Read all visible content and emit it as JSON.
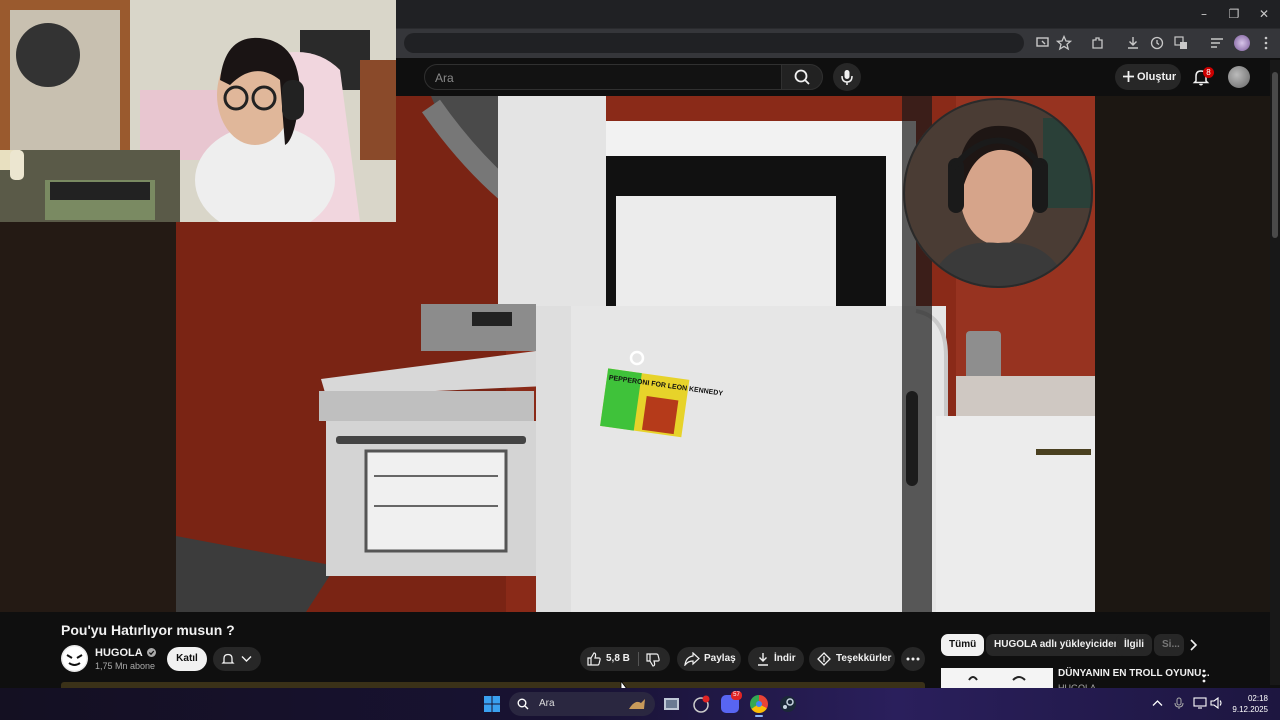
{
  "browser": {
    "window_controls": {
      "minimize": "–",
      "maximize": "❐",
      "close": "✕"
    }
  },
  "youtube": {
    "search_placeholder": "Ara",
    "create_label": "Oluştur",
    "notification_count": "8"
  },
  "video": {
    "title": "Pou'yu Hatırlıyor musun ?",
    "channel": "HUGOLA",
    "subscribers": "1,75 Mn abone",
    "join_label": "Katıl",
    "like_count": "5,8 B",
    "share_label": "Paylaş",
    "download_label": "İndir",
    "thanks_label": "Teşekkürler",
    "sticker_text": "PEPPERONI FOR LEON KENNEDY"
  },
  "sidebar": {
    "chips": [
      "Tümü",
      "HUGOLA adlı yükleyiciden",
      "İlgili",
      "Si..."
    ],
    "recommended": [
      {
        "title": "DÜNYANIN EN TROLL OYUNU...",
        "channel": "HUGOLA"
      }
    ]
  },
  "taskbar": {
    "search_label": "Ara",
    "discord_badge": "57",
    "time": "02:18",
    "date": "9.12.2025"
  },
  "colors": {
    "yt_bg": "#0f0f0f",
    "accent_red": "#cc0000",
    "wall_red": "#8a2a18"
  }
}
